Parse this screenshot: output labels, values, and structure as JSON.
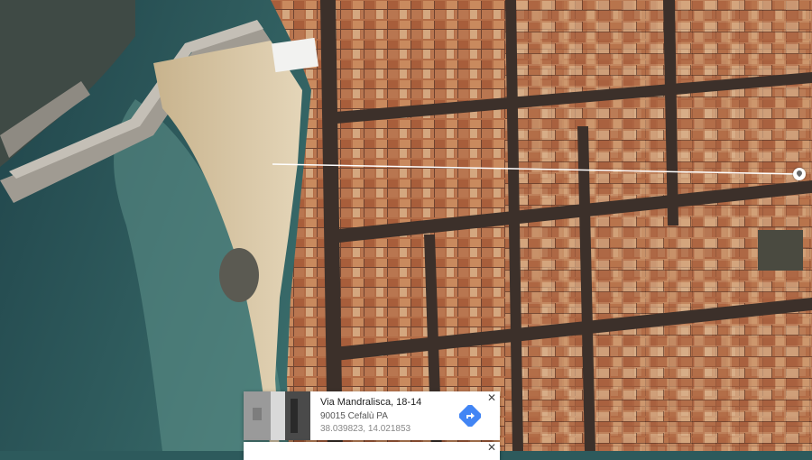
{
  "map": {
    "view": "satellite",
    "colors": {
      "sea_deep": "#23474a",
      "sea_shallow": "#4f8a86",
      "beach": "#d8c6a6",
      "roofs_a": "#b06a45",
      "roofs_b": "#c48a5f",
      "roofs_c": "#d9b48c",
      "streets": "#3a2f2a",
      "pier": "#9a958c",
      "measure_line": "#ffffff"
    }
  },
  "place_card": {
    "title": "Via Mandralisca, 18-14",
    "address": "90015 Cefalù PA",
    "coordinates": "38.039823, 14.021853",
    "directions_icon": "directions-arrow-icon",
    "close_label": "✕",
    "accent": "#4285f4"
  },
  "second_card": {
    "close_label": "✕"
  }
}
